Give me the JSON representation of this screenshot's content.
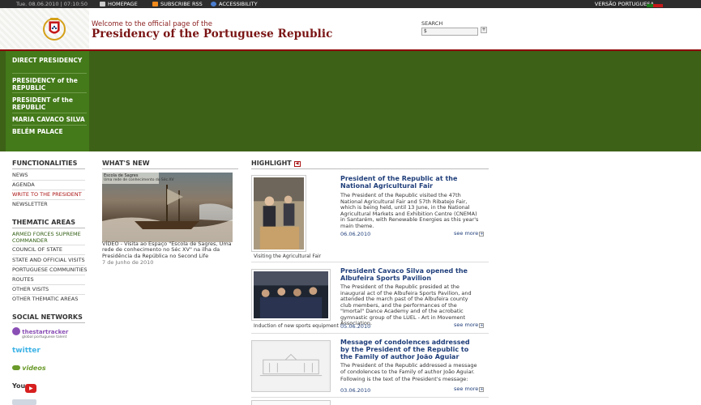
{
  "topbar": {
    "date": "Tue. 08.06.2010 | 07:10:50",
    "homepage": "HOMEPAGE",
    "rss": "SUBSCRIBE RSS",
    "accessibility": "ACCESSIBILITY",
    "language": "VERSÃO PORTUGUESA"
  },
  "header": {
    "welcome": "Welcome to the official page of the",
    "title": "Presidency of the Portuguese Republic",
    "search_label": "SEARCH",
    "search_value": "$"
  },
  "main_nav": [
    "DIRECT PRESIDENCY",
    "PRESIDENCY of the REPUBLIC",
    "PRESIDENT of the REPUBLIC",
    "MARIA CAVACO SILVA",
    "BELÉM PALACE"
  ],
  "functionalities": {
    "title": "FUNCTIONALITIES",
    "items": [
      "NEWS",
      "AGENDA",
      "WRITE TO THE PRESIDENT",
      "NEWSLETTER"
    ]
  },
  "thematic": {
    "title": "THEMATIC AREAS",
    "items": [
      "ARMED FORCES SUPREME COMMANDER",
      "COUNCIL OF STATE",
      "STATE AND OFFICIAL VISITS",
      "PORTUGUESE COMMUNITIES",
      "ROUTES",
      "OTHER VISITS",
      "OTHER THEMATIC AREAS"
    ]
  },
  "social": {
    "title": "SOCIAL NETWORKS",
    "startracker": "thestartracker",
    "startracker_sub": "global portuguese talent",
    "twitter": "twitter",
    "videos": "videos",
    "youtube": "You"
  },
  "whats_new": {
    "title": "WHAT'S NEW",
    "image_text1": "Escola de Sagres",
    "image_text2": "Uma rede de conhecimento do Séc.XV",
    "caption": "VÍDEO - Visita ao Espaço \"Escola de Sagres, Uma rede de conhecimento no Séc XV\" na ilha da Presidência da República no Second Life",
    "date": "7 de Junho de 2010"
  },
  "highlight": {
    "title": "HIGHLIGHT",
    "see_more": "see more",
    "items": [
      {
        "title": "President of the Republic at the National Agricultural Fair",
        "body": "The President of the Republic visited the 47th National Agricultural Fair and 57th Ribatejo Fair, which is being held, until 13 June, in the National Agricultural Markets and Exhibition Centre (CNEMA) in Santarém, with Renewable Energies as this year's main theme.",
        "date": "06.06.2010",
        "caption": "Visiting the Agricultural Fair"
      },
      {
        "title": "President Cavaco Silva opened the Albufeira Sports Pavilion",
        "body": "The President of the Republic presided at the inaugural act of the Albufeira Sports Pavilion, and attended the march past of the Albufeira county club members, and the performances of the \"Imortal\" Dance Academy and of the acrobatic gymnastic group of the LUEL - Art in Movement Association.",
        "date": "05.06.2010",
        "caption": "Induction of new sports equipment"
      },
      {
        "title": "Message of condolences addressed by the President of the Republic to the Family of author João Aguiar",
        "body": "The President of the Republic addressed a message of condolences to the Family of author João Aguiar.",
        "body2": "Following is the text of the President's message:",
        "date": "03.06.2010"
      }
    ]
  },
  "colors": {
    "dark_green": "#3d6117",
    "nav_green": "#447a1a",
    "crimson": "#7a1414",
    "link_blue": "#1f3e7a"
  }
}
